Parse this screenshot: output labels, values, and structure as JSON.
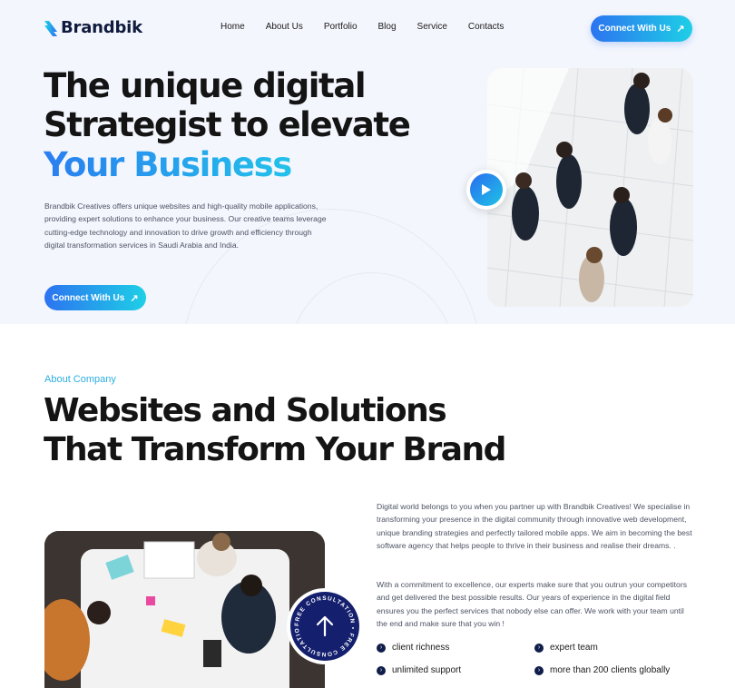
{
  "brand": {
    "name": "Brandbik"
  },
  "nav": [
    "Home",
    "About Us",
    "Portfolio",
    "Blog",
    "Service",
    "Contacts"
  ],
  "header": {
    "cta_label": "Connect With Us"
  },
  "hero": {
    "title_line1": "The unique digital",
    "title_line2": "Strategist to elevate",
    "title_line3": "Your Business",
    "description": "Brandbik Creatives offers unique websites and high-quality mobile applications, providing expert solutions to enhance your business. Our creative teams leverage cutting-edge technology and innovation to drive growth and efficiency through digital transformation services in Saudi Arabia and India.",
    "cta_label": "Connect With Us"
  },
  "about": {
    "label": "About Company",
    "title_line1": "Websites and Solutions",
    "title_line2": "That Transform Your Brand",
    "paragraph1": "Digital world belongs to you when you partner up with Brandbik Creatives! We specialise in transforming your presence in the digital community through innovative web development, unique branding strategies and perfectly tailored mobile apps. We aim in becoming the best software agency that helps people to thrive in their business and realise their dreams. .",
    "paragraph2": "With a commitment to excellence, our experts make sure that you outrun your competitors and get delivered the best possible results. Our years of experience in the digital field ensures you the perfect services that nobody else can offer. We work with your team until the end and make sure that you win !",
    "features": [
      "client richness",
      "expert team",
      "unlimited support",
      "more than 200 clients globally"
    ],
    "badge_text": "FREE CONSULTATION • FREE CONSULTATION •"
  },
  "colors": {
    "accent": "#2b8ef0",
    "accent2": "#1ecfe6",
    "navy": "#14206e",
    "hero_bg": "#f4f6fd"
  },
  "icons": [
    "brand-logo-icon",
    "arrow-up-right-icon",
    "play-icon",
    "chevron-right-icon"
  ]
}
